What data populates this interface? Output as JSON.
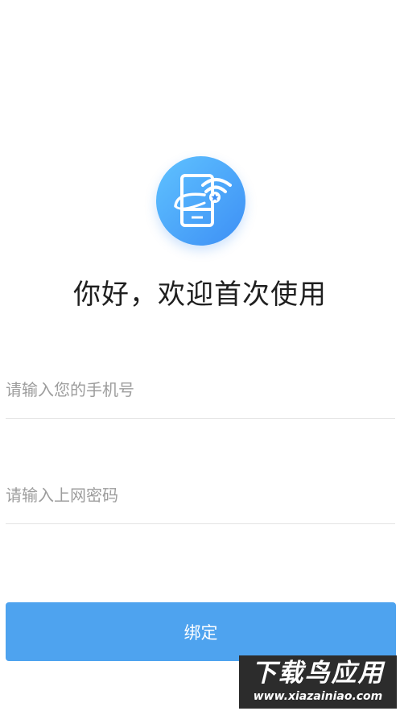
{
  "logo": {
    "icon": "phone-wifi-icon",
    "gradient": [
      "#5fc2ff",
      "#3d8ff5"
    ]
  },
  "welcome_title": "你好，欢迎首次使用",
  "form": {
    "phone_placeholder": "请输入您的手机号",
    "password_placeholder": "请输入上网密码"
  },
  "bind_button": {
    "label": "绑定",
    "color": "#4ea3ef"
  },
  "watermark": {
    "title": "下载鸟应用",
    "url": "www.xiazainiao.com"
  }
}
